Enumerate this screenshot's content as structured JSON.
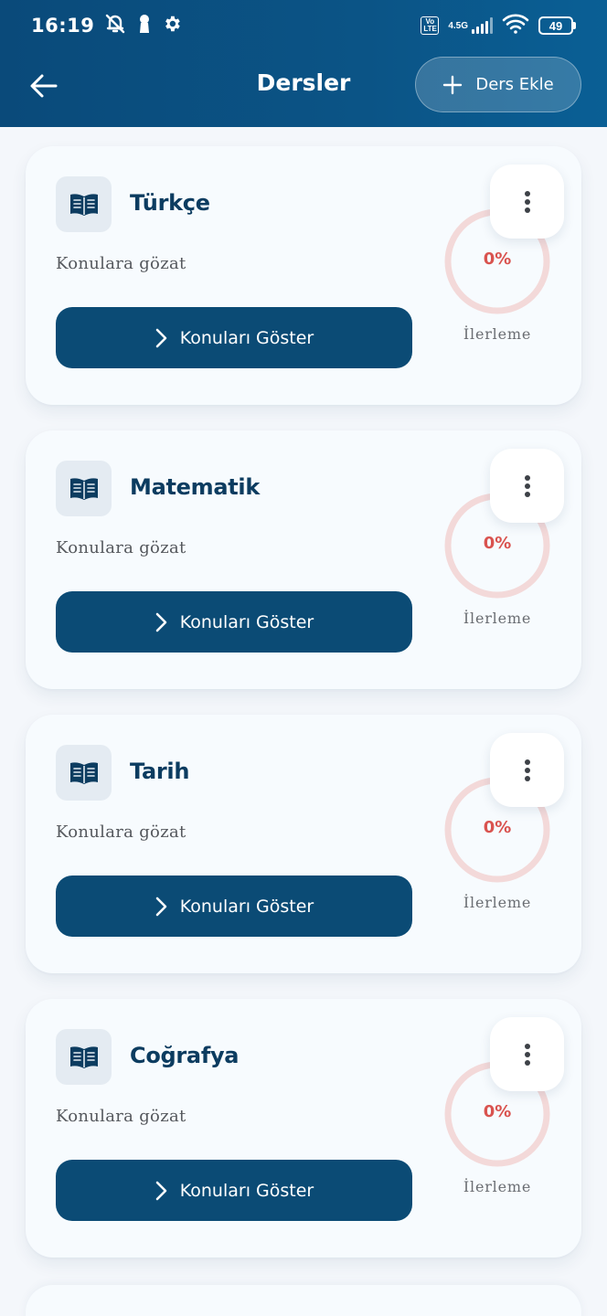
{
  "status_bar": {
    "time": "16:19",
    "network": "4.5G",
    "volte": "Vo LTE",
    "battery": "49"
  },
  "header": {
    "title": "Dersler",
    "add_button_label": "Ders Ekle"
  },
  "colors": {
    "header": "#0b5486",
    "primary_button": "#0b4b75",
    "title_text": "#0c3c60",
    "progress_text": "#d9534f",
    "progress_ring": "#f3d9d9"
  },
  "courses": [
    {
      "title": "Türkçe",
      "subtitle": "Konulara gözat",
      "button_label": "Konuları Göster",
      "progress_text": "0%",
      "progress_value": 0,
      "progress_label": "İlerleme"
    },
    {
      "title": "Matematik",
      "subtitle": "Konulara gözat",
      "button_label": "Konuları Göster",
      "progress_text": "0%",
      "progress_value": 0,
      "progress_label": "İlerleme"
    },
    {
      "title": "Tarih",
      "subtitle": "Konulara gözat",
      "button_label": "Konuları Göster",
      "progress_text": "0%",
      "progress_value": 0,
      "progress_label": "İlerleme"
    },
    {
      "title": "Coğrafya",
      "subtitle": "Konulara gözat",
      "button_label": "Konuları Göster",
      "progress_text": "0%",
      "progress_value": 0,
      "progress_label": "İlerleme"
    }
  ]
}
